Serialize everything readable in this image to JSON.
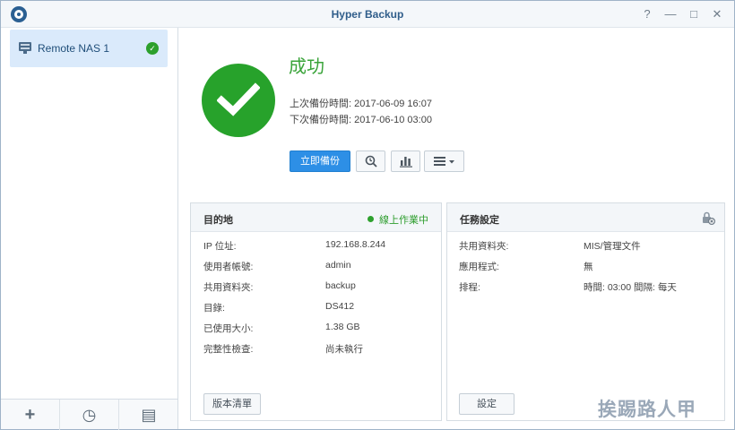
{
  "window": {
    "title": "Hyper Backup",
    "controls": {
      "help": "?",
      "minimize": "—",
      "maximize": "□",
      "close": "✕"
    }
  },
  "sidebar": {
    "task_name": "Remote NAS 1",
    "task_icon": "nas-icon",
    "task_status_icon": "check-icon",
    "footer_buttons": [
      {
        "icon": "add-icon",
        "glyph": "+"
      },
      {
        "icon": "restore-icon",
        "glyph": "◷"
      },
      {
        "icon": "log-icon",
        "glyph": "▤"
      }
    ]
  },
  "status": {
    "title": "成功",
    "last_backup": "上次備份時間: 2017-06-09 16:07",
    "next_backup": "下次備份時間: 2017-06-10 03:00",
    "backup_now_label": "立即備份",
    "success_color": "#27a22b"
  },
  "destination": {
    "title": "目的地",
    "status": "線上作業中",
    "rows": [
      {
        "label": "IP 位址:",
        "value": "192.168.8.244"
      },
      {
        "label": "使用者帳號:",
        "value": "admin"
      },
      {
        "label": "共用資料夾:",
        "value": "backup"
      },
      {
        "label": "目錄:",
        "value": "DS412"
      },
      {
        "label": "已使用大小:",
        "value": "1.38 GB"
      },
      {
        "label": "完整性檢查:",
        "value": "尚未執行"
      }
    ],
    "button_label": "版本清單"
  },
  "task_settings": {
    "title": "任務設定",
    "rows": [
      {
        "label": "共用資料夾:",
        "value": "MIS/管理文件"
      },
      {
        "label": "應用程式:",
        "value": "無"
      },
      {
        "label": "排程:",
        "value": "時間: 03:00 間隔: 每天"
      }
    ],
    "button_label": "設定"
  },
  "watermark": "挨踢路人甲",
  "colors": {
    "accent": "#2d8fe6",
    "title": "#2f5d8a",
    "online": "#2ea12e"
  }
}
